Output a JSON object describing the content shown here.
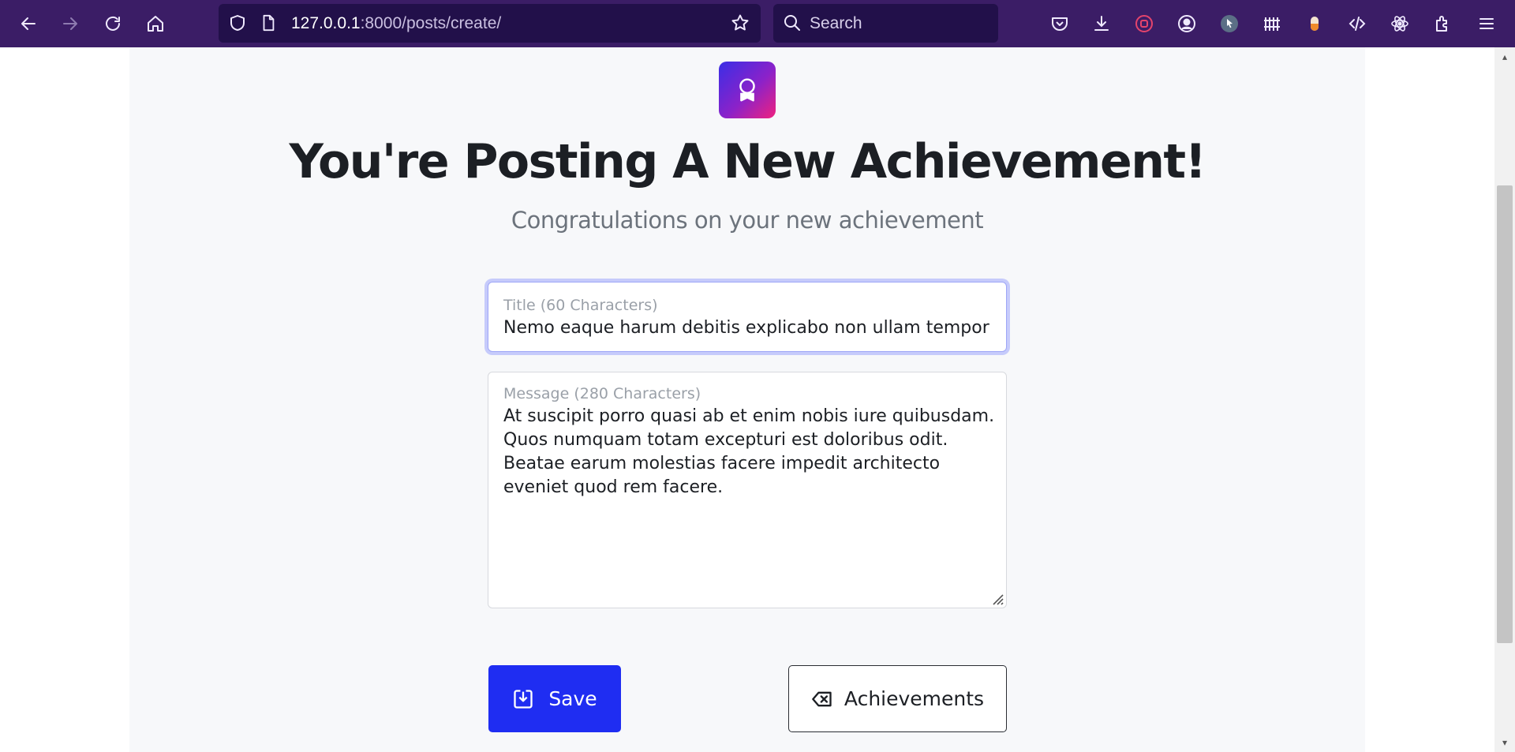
{
  "browser": {
    "url_host": "127.0.0.1",
    "url_path": ":8000/posts/create/",
    "search_placeholder": "Search"
  },
  "page": {
    "heading": "You're Posting A New Achievement!",
    "subheading": "Congratulations on your new achievement",
    "title_field": {
      "label": "Title (60 Characters)",
      "value": "Nemo eaque harum debitis explicabo non ullam tempor"
    },
    "message_field": {
      "label": "Message (280 Characters)",
      "value": "At suscipit porro quasi ab et enim nobis iure quibusdam. Quos numquam totam excepturi est doloribus odit. Beatae earum molestias facere impedit architecto eveniet quod rem facere."
    },
    "save_label": "Save",
    "achievements_label": "Achievements"
  },
  "colors": {
    "toolbar": "#3b1d66",
    "primary_button": "#1f2df2",
    "focus_ring": "#c6cbfb"
  }
}
